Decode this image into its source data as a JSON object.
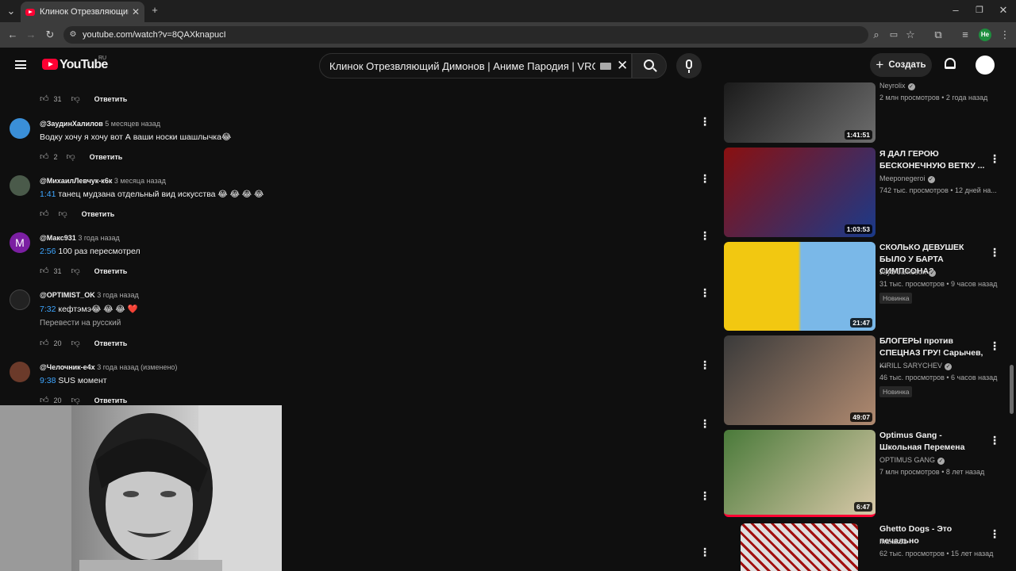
{
  "browser": {
    "tab_title": "Клинок Отрезвляющий Димоно",
    "url": "youtube.com/watch?v=8QAXknapucI",
    "profile_badge": "Не"
  },
  "youtube": {
    "logo_text": "YouTube",
    "region": "RU",
    "search_value": "Клинок Отрезвляющий Димонов | Аниме Пародия | VRChat",
    "create_label": "Создать"
  },
  "comments": [
    {
      "author": "",
      "time": "",
      "timestamp": "",
      "text": "",
      "likes": "31",
      "reply": "Ответить"
    },
    {
      "author": "@ЗаудинХалилов",
      "time": "5 месяцев назад",
      "timestamp": "",
      "text": "Водку хочу я хочу вот А ваши носки шашлычка😂",
      "likes": "2",
      "reply": "Ответить"
    },
    {
      "author": "@МихаилЛевчук-к6к",
      "time": "3 месяца назад",
      "timestamp": "1:41",
      "text": " танец мудзана отдельный вид искусства 😂 😂 😂 😂",
      "likes": "",
      "reply": "Ответить"
    },
    {
      "author": "@Макс931",
      "time": "3 года назад",
      "timestamp": "2:56",
      "text": " 100 раз пересмотрел",
      "likes": "31",
      "reply": "Ответить"
    },
    {
      "author": "@OPTIMIST_OK",
      "time": "3 года назад",
      "timestamp": "7:32",
      "text": " кефтэмэ😂 😂 😂 ❤️",
      "translate": "Перевести на русский",
      "likes": "20",
      "reply": "Ответить"
    },
    {
      "author": "@Челочник-е4х",
      "time": "3 года назад (изменено)",
      "timestamp": "9:38",
      "text": " SUS момент",
      "likes": "20",
      "reply": "Ответить"
    }
  ],
  "sidebar_videos": [
    {
      "title": "",
      "channel": "Neyrolix",
      "meta": "2 млн просмотров • 2 года назад",
      "duration": "1:41:51",
      "badge": "",
      "thumb_colors": [
        "#1b1b1b",
        "#6d6d6d"
      ]
    },
    {
      "title": "Я ДАЛ ГЕРОЮ БЕСКОНЕЧНУЮ ВЕТКУ ...",
      "channel": "Meeponegeroi",
      "meta": "742 тыс. просмотров • 12 дней на...",
      "duration": "1:03:53",
      "badge": "",
      "thumb_colors": [
        "#8a1010",
        "#1a3a8a"
      ]
    },
    {
      "title": "СКОЛЬКО ДЕВУШЕК БЫЛО У БАРТА СИМПСОНА?",
      "channel": "JayS Jameson",
      "meta": "31 тыс. просмотров • 9 часов назад",
      "duration": "21:47",
      "badge": "Новинка",
      "thumb_colors": [
        "#f2c811",
        "#7ab8e8"
      ]
    },
    {
      "title": "БЛОГЕРЫ против СПЕЦНАЗ ГРУ! Сарычев, ...",
      "channel": "KIRILL SARYCHEV",
      "meta": "46 тыс. просмотров • 6 часов назад",
      "duration": "49:07",
      "badge": "Новинка",
      "thumb_colors": [
        "#3a3a3a",
        "#b08a70"
      ]
    },
    {
      "title": "Optimus Gang - Школьная Перемена",
      "channel": "OPTIMUS GANG",
      "meta": "7 млн просмотров • 8 лет назад",
      "duration": "6:47",
      "badge": "",
      "thumb_colors": [
        "#4a7a3a",
        "#d8c8a8"
      ]
    },
    {
      "title": "Ghetto Dogs - Это печально",
      "channel": "maxat13",
      "meta": "62 тыс. просмотров • 15 лет назад",
      "duration": "",
      "badge": "",
      "thumb_colors": [
        "#d8d8d8",
        "#a01010"
      ]
    }
  ],
  "colors": {
    "accent": "#ff0033",
    "link": "#3ea6ff",
    "background": "#0f0f0f"
  }
}
